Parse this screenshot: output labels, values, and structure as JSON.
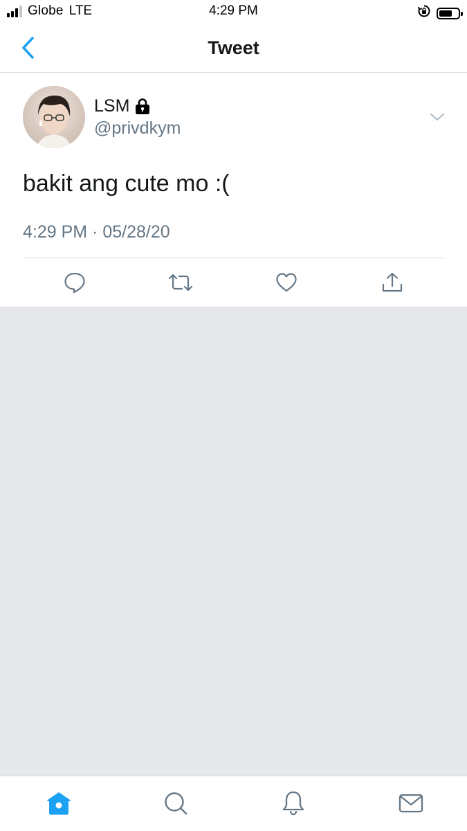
{
  "status_bar": {
    "carrier": "Globe",
    "network": "LTE",
    "time": "4:29 PM",
    "signal_bars_filled": 3,
    "signal_bars_total": 4
  },
  "header": {
    "title": "Tweet",
    "back_icon": "chevron-left-icon"
  },
  "tweet": {
    "display_name": "LSM",
    "protected_icon": "lock-icon",
    "handle": "@privdkym",
    "text": "bakit ang cute mo :(",
    "timestamp": "4:29 PM · 05/28/20",
    "actions": [
      "reply-icon",
      "retweet-icon",
      "like-icon",
      "share-icon"
    ]
  },
  "tab_bar": {
    "items": [
      "home-icon",
      "search-icon",
      "notifications-icon",
      "messages-icon"
    ],
    "active": "home"
  },
  "colors": {
    "accent": "#1da1f2",
    "icon_gray": "#657786",
    "background": "#e6e8ec",
    "text": "#14171a"
  }
}
